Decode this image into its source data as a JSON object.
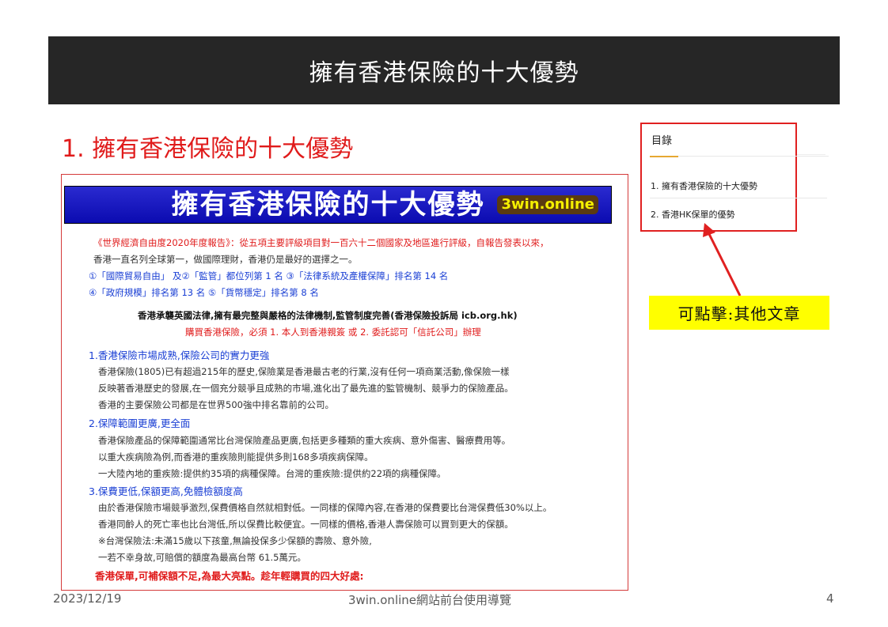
{
  "slide": {
    "title": "擁有香港保險的十大優勢",
    "section_heading": "1. 擁有香港保險的十大優勢"
  },
  "article": {
    "banner_title": "擁有香港保險的十大優勢",
    "banner_brand": "3win.online",
    "intro": [
      "《世界經濟自由度2020年度報告》：從五項主要評級項目對一百六十二個國家及地區進行評級，自報告發表以來，",
      "香港一直名列全球第一，做國際理財，香港仍是最好的選擇之一。",
      "①「國際貿易自由」 及②「監管」都位列第 1 名   ③「法律系統及產權保障」排名第 14 名",
      "④「政府規模」排名第 13 名                 ⑤「貨幣穩定」排名第 8 名"
    ],
    "law_line": "香港承襲英國法律,擁有最完整與嚴格的法律機制,監管制度完善(香港保險投訴局 icb.org.hk)",
    "buy_line": "購買香港保險，必須 1. 本人到香港親簽 或 2. 委託認可「信託公司」辦理",
    "point1_heading": "1.香港保險市場成熟,保險公司的實力更強",
    "point1_lines": [
      "香港保險(1805)已有超過215年的歷史,保險業是香港最古老的行業,沒有任何一項商業活動,像保險一樣",
      "反映著香港歷史的發展,在一個充分競爭且成熟的市場,進化出了最先進的監管機制、競爭力的保險產品。",
      "香港的主要保險公司都是在世界500強中排名靠前的公司。"
    ],
    "point2_heading": "2.保障範圍更廣,更全面",
    "point2_lines": [
      "香港保險產品的保障範圍通常比台灣保險產品更廣,包括更多種類的重大疾病、意外傷害、醫療費用等。",
      "以重大疾病險為例,而香港的重疾險則能提供多則168多項疾病保障。",
      "一大陸內地的重疾險:提供約35項的病種保障。台灣的重疾險:提供約22項的病種保障。"
    ],
    "point3_heading": "3.保費更低,保額更高,免體檢額度高",
    "point3_lines": [
      "由於香港保險市場競爭激烈,保費價格自然就相對低。一同樣的保障內容,在香港的保費要比台灣保費低30%以上。",
      "香港同齡人的死亡率也比台灣低,所以保費比較便宜。一同樣的價格,香港人壽保險可以買到更大的保額。",
      "※台灣保險法:未滿15歲以下孩童,無論投保多少保額的壽險、意外險,",
      "一若不幸身故,可賠償的額度為最高台幣 61.5萬元。"
    ],
    "closing_line": "香港保單,可補保額不足,為最大亮點。趁年輕購買的四大好處:"
  },
  "toc": {
    "title": "目錄",
    "items": [
      "1.  擁有香港保險的十大優勢",
      "2.  香港HK保單的優勢"
    ]
  },
  "callout": {
    "text": "可點擊:其他文章"
  },
  "footer": {
    "date": "2023/12/19",
    "center": "3win.online網站前台使用導覽",
    "page_number": "4"
  },
  "colors": {
    "title_bar": "#262626",
    "heading_red": "#e01b1b",
    "banner_blue": "#0b0bb0",
    "callout_yellow": "#ffff00",
    "highlight_border": "#e02020"
  }
}
